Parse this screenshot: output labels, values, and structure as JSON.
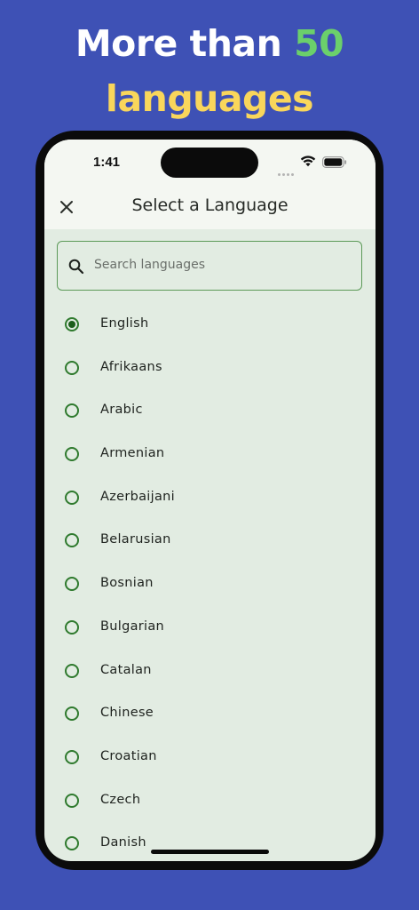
{
  "promo": {
    "line1_prefix": "More than ",
    "line1_number": "50",
    "line2": "languages",
    "colors": {
      "background": "#3e51b5",
      "text": "#ffffff",
      "number": "#6bd06b",
      "line2": "#f9d65b"
    }
  },
  "status_bar": {
    "time": "1:41",
    "icons": [
      "signal-icon",
      "wifi-icon",
      "battery-icon"
    ]
  },
  "app_bar": {
    "title": "Select a Language",
    "close_icon": "close-icon"
  },
  "search": {
    "placeholder": "Search languages",
    "value": "",
    "icon": "search-icon"
  },
  "languages": {
    "selected": "English",
    "items": [
      {
        "label": "English",
        "selected": true
      },
      {
        "label": "Afrikaans",
        "selected": false
      },
      {
        "label": "Arabic",
        "selected": false
      },
      {
        "label": "Armenian",
        "selected": false
      },
      {
        "label": "Azerbaijani",
        "selected": false
      },
      {
        "label": "Belarusian",
        "selected": false
      },
      {
        "label": "Bosnian",
        "selected": false
      },
      {
        "label": "Bulgarian",
        "selected": false
      },
      {
        "label": "Catalan",
        "selected": false
      },
      {
        "label": "Chinese",
        "selected": false
      },
      {
        "label": "Croatian",
        "selected": false
      },
      {
        "label": "Czech",
        "selected": false
      },
      {
        "label": "Danish",
        "selected": false
      }
    ]
  },
  "theme": {
    "accent": "#2f7a2e",
    "list_background": "#e2ece2",
    "header_background": "#f4f7f2"
  }
}
